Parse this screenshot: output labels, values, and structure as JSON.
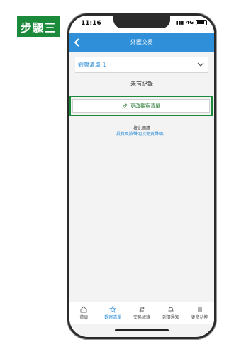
{
  "step_label": "步驟三",
  "status": {
    "time": "11:16",
    "network": "4G"
  },
  "header": {
    "title": "外匯交易"
  },
  "watchlist": {
    "selected": "觀察清單 1"
  },
  "empty_state": "未有紀錄",
  "edit_button_label": "更改觀察清單",
  "disclaimer": {
    "line1": "按此閱讀",
    "line2": "投資風險聲明及免責聲明。"
  },
  "tabs": [
    {
      "label": "首頁",
      "icon": "home-icon"
    },
    {
      "label": "觀察清單",
      "icon": "star-icon"
    },
    {
      "label": "交易紀錄",
      "icon": "swap-icon"
    },
    {
      "label": "到價通知",
      "icon": "bell-icon"
    },
    {
      "label": "更多功能",
      "icon": "menu-icon"
    }
  ],
  "colors": {
    "accent": "#2f8fd8",
    "highlight": "#1b8a3a"
  }
}
